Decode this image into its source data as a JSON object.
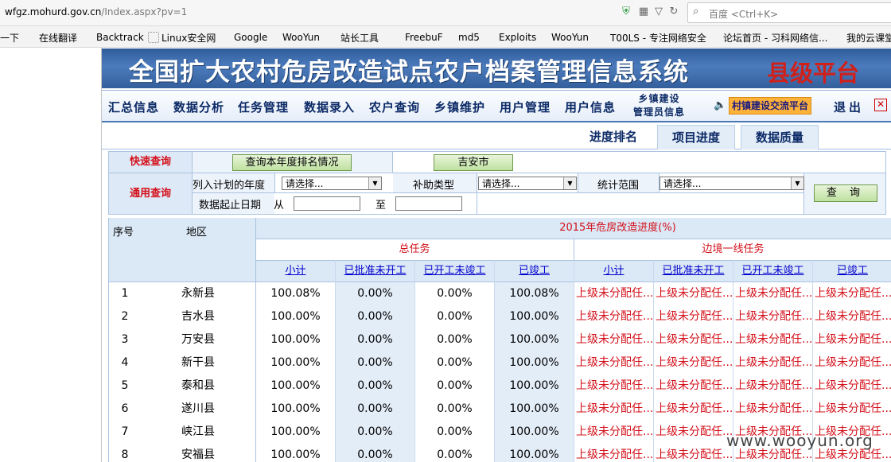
{
  "browser": {
    "url_host": "wfgz.mohurd.gov.cn",
    "url_path": "/Index.aspx?pv=1",
    "url_prefix": "",
    "search_placeholder": "百度 <Ctrl+K>"
  },
  "bookmarks": [
    {
      "label": "一下",
      "icon": "",
      "color": ""
    },
    {
      "label": "在线翻译",
      "icon": "Y",
      "color": "#d9232a"
    },
    {
      "label": "Backtrack",
      "icon": "✎",
      "color": "#333333"
    },
    {
      "label": "Linux安全网",
      "icon": "",
      "color": "#999999"
    },
    {
      "label": "Google",
      "icon": "8",
      "color": "#4a7cd8"
    },
    {
      "label": "WooYun",
      "icon": "▲",
      "color": "#222222"
    },
    {
      "label": "站长工具",
      "icon": "▮",
      "color": "#2a66c8"
    },
    {
      "label": "FreebuF",
      "icon": "F",
      "color": "#2e9b2e"
    },
    {
      "label": "md5",
      "icon": "▦",
      "color": "#2f4a8a"
    },
    {
      "label": "Exploits",
      "icon": "✸",
      "color": "#e06a1a"
    },
    {
      "label": "WooYun",
      "icon": "▲",
      "color": "#222222"
    },
    {
      "label": "T00LS - 专注网络安全",
      "icon": "7",
      "color": "#222222"
    },
    {
      "label": "论坛首页 - 习科网络信...",
      "icon": "SL",
      "color": "#d9232a"
    },
    {
      "label": "我的云课堂",
      "icon": "■",
      "color": "#2f8a2f"
    }
  ],
  "banner": {
    "title": "全国扩大农村危房改造试点农户档案管理信息系统",
    "badge": "县级平台"
  },
  "nav": {
    "items": [
      "汇总信息",
      "数据分析",
      "任务管理",
      "数据录入",
      "农户查询",
      "乡镇维护",
      "用户管理",
      "用户信息"
    ],
    "two_line_top": "乡镇建设",
    "two_line_bottom": "管理员信息",
    "exchange": "村镇建设交流平台",
    "logout": "退出"
  },
  "tabs": [
    "进度排名",
    "项目进度",
    "数据质量"
  ],
  "query": {
    "quick_label": "快速查询",
    "quick_btn": "查询本年度排名情况",
    "city_btn": "吉安市",
    "general_label": "通用查询",
    "year_label": "列入计划的年度",
    "year_value": "请选择...",
    "subsidy_label": "补助类型",
    "subsidy_value": "请选择...",
    "scope_label": "统计范围",
    "scope_value": "请选择...",
    "date_label": "数据起止日期",
    "from_label": "从",
    "to_label": "至",
    "search_btn": "查 询"
  },
  "table": {
    "col_index": "序号",
    "col_region": "地区",
    "progress_title": "2015年危房改造进度(%)",
    "group_total": "总任务",
    "group_border": "边境一线任务",
    "sub_headers": [
      "小计",
      "已批准未开工",
      "已开工未竣工",
      "已竣工",
      "小计",
      "已批准未开工",
      "已开工未竣工",
      "已竣工"
    ],
    "rows": [
      {
        "no": "1",
        "region": "永新县",
        "v": [
          "100.08%",
          "0.00%",
          "0.00%",
          "100.08%"
        ]
      },
      {
        "no": "2",
        "region": "吉水县",
        "v": [
          "100.00%",
          "0.00%",
          "0.00%",
          "100.00%"
        ]
      },
      {
        "no": "3",
        "region": "万安县",
        "v": [
          "100.00%",
          "0.00%",
          "0.00%",
          "100.00%"
        ]
      },
      {
        "no": "4",
        "region": "新干县",
        "v": [
          "100.00%",
          "0.00%",
          "0.00%",
          "100.00%"
        ]
      },
      {
        "no": "5",
        "region": "泰和县",
        "v": [
          "100.00%",
          "0.00%",
          "0.00%",
          "100.00%"
        ]
      },
      {
        "no": "6",
        "region": "遂川县",
        "v": [
          "100.00%",
          "0.00%",
          "0.00%",
          "100.00%"
        ]
      },
      {
        "no": "7",
        "region": "峡江县",
        "v": [
          "100.00%",
          "0.00%",
          "0.00%",
          "100.00%"
        ]
      },
      {
        "no": "8",
        "region": "安福县",
        "v": [
          "100.00%",
          "0.00%",
          "0.00%",
          "100.00%"
        ]
      }
    ],
    "unassigned_text": "上级未分配任..."
  },
  "watermark": "www.wooyun.org"
}
